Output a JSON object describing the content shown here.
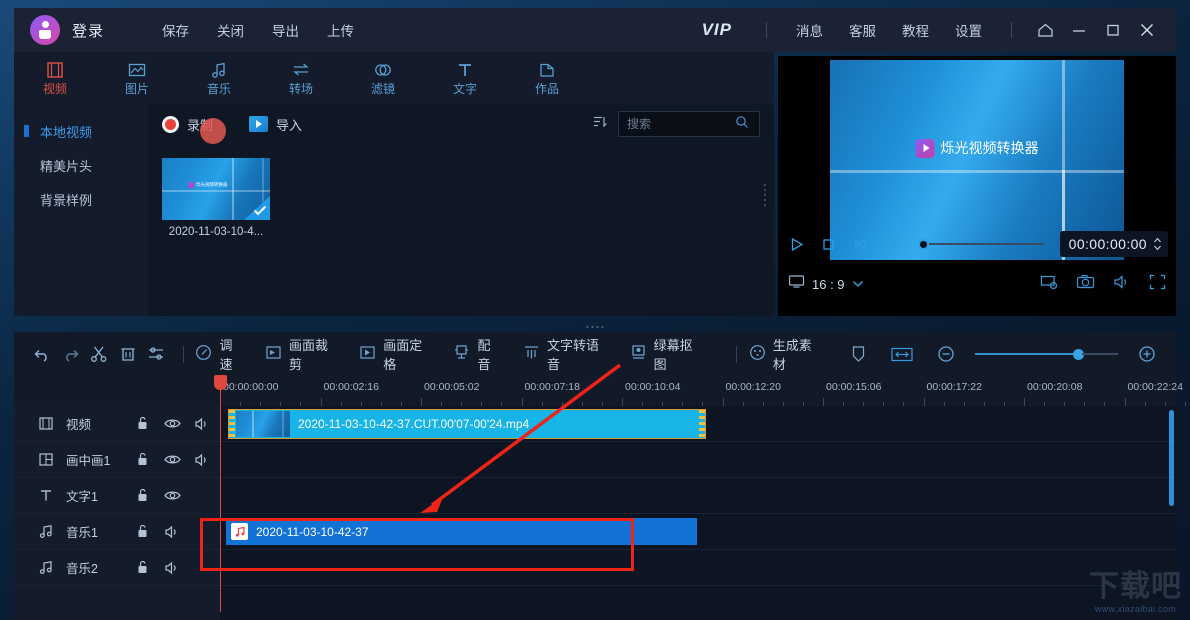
{
  "titlebar": {
    "login_label": "登录",
    "logo_icon": "user-avatar-icon",
    "menu": [
      "保存",
      "关闭",
      "导出",
      "上传"
    ],
    "vip_label": "VIP",
    "right_menu": [
      "消息",
      "客服",
      "教程",
      "设置"
    ],
    "home_icon": "home-icon",
    "minimize_icon": "minimize-icon",
    "maximize_icon": "maximize-icon",
    "close_icon": "close-icon"
  },
  "tabs": [
    {
      "label": "视频",
      "icon": "film-icon",
      "active": true
    },
    {
      "label": "图片",
      "icon": "image-icon",
      "active": false
    },
    {
      "label": "音乐",
      "icon": "music-note-icon",
      "active": false
    },
    {
      "label": "转场",
      "icon": "transition-icon",
      "active": false
    },
    {
      "label": "滤镜",
      "icon": "filter-rings-icon",
      "active": false
    },
    {
      "label": "文字",
      "icon": "text-t-icon",
      "active": false
    },
    {
      "label": "作品",
      "icon": "folder-icon",
      "active": false
    }
  ],
  "sidebar": {
    "items": [
      {
        "label": "本地视频",
        "active": true
      },
      {
        "label": "精美片头",
        "active": false
      },
      {
        "label": "背景样例",
        "active": false
      }
    ]
  },
  "media_panel": {
    "record_label": "录制",
    "import_label": "导入",
    "sort_icon": "sort-icon",
    "search_placeholder": "搜索",
    "search_value": "",
    "search_icon": "search-icon",
    "items": [
      {
        "name": "2020-11-03-10-4...",
        "selected": true,
        "watermark": "烁光视频转换器"
      }
    ]
  },
  "preview": {
    "watermark": "烁光视频转换器",
    "play_icon": "play-icon",
    "stop_icon": "stop-icon",
    "prev_icon": "prev-frame-icon",
    "next_icon": "next-frame-icon",
    "timecode": "00:00:00:00",
    "stepper_icon": "stepper-up-down-icon",
    "ratio_icon": "monitor-icon",
    "ratio_value": "16 : 9",
    "ratio_caret": "chevron-down-icon",
    "settings_icon": "display-settings-icon",
    "snapshot_icon": "camera-icon",
    "volume_icon": "speaker-icon",
    "fullscreen_icon": "fullscreen-icon"
  },
  "edit_toolbar": {
    "undo_icon": "undo-icon",
    "redo_icon": "redo-icon",
    "cut_icon": "scissors-icon",
    "delete_icon": "trash-icon",
    "adjust_icon": "sliders-icon",
    "buttons": [
      {
        "label": "调速",
        "icon": "speed-gauge-icon"
      },
      {
        "label": "画面裁剪",
        "icon": "crop-icon"
      },
      {
        "label": "画面定格",
        "icon": "freeze-frame-icon"
      },
      {
        "label": "配音",
        "icon": "dubbing-icon"
      },
      {
        "label": "文字转语音",
        "icon": "text-to-speech-icon"
      },
      {
        "label": "绿幕抠图",
        "icon": "green-screen-icon"
      },
      {
        "label": "生成素材",
        "icon": "generate-material-icon"
      }
    ],
    "marker_icon": "marker-icon",
    "fit_icon": "fit-width-icon",
    "zoom_out_icon": "zoom-out-icon",
    "zoom_in_icon": "zoom-in-icon"
  },
  "timeline": {
    "ticks": [
      "00:00:00:00",
      "00:00:02:16",
      "00:00:05:02",
      "00:00:07:18",
      "00:00:10:04",
      "00:00:12:20",
      "00:00:15:06",
      "00:00:17:22",
      "00:00:20:08",
      "00:00:22:24"
    ],
    "tracks": [
      {
        "label": "视频",
        "icon": "film-track-icon",
        "lock": true,
        "eye": true,
        "audio": true
      },
      {
        "label": "画中画1",
        "icon": "pip-track-icon",
        "lock": true,
        "eye": true,
        "audio": true
      },
      {
        "label": "文字1",
        "icon": "text-track-icon",
        "lock": true,
        "eye": true,
        "audio": false
      },
      {
        "label": "音乐1",
        "icon": "music-track-icon",
        "lock": true,
        "eye": false,
        "audio": true
      },
      {
        "label": "音乐2",
        "icon": "music-track-icon",
        "lock": true,
        "eye": false,
        "audio": true
      }
    ],
    "video_clip_label": "2020-11-03-10-42-37.CUT.00'07-00'24.mp4",
    "audio_clip_label": "2020-11-03-10-42-37",
    "lock_icon": "lock-icon",
    "eye_icon": "eye-icon",
    "speaker_icon": "speaker-icon",
    "music_clip_icon": "music-note-icon"
  },
  "watermark_br": {
    "title": "下载吧",
    "url": "www.xiazaibai.com"
  },
  "colors": {
    "accent_blue": "#2d8fd6",
    "active_red": "#e0504a",
    "clip_cyan": "#17b4e8",
    "clip_blue": "#1272d6",
    "annotation_red": "#ee2418"
  }
}
